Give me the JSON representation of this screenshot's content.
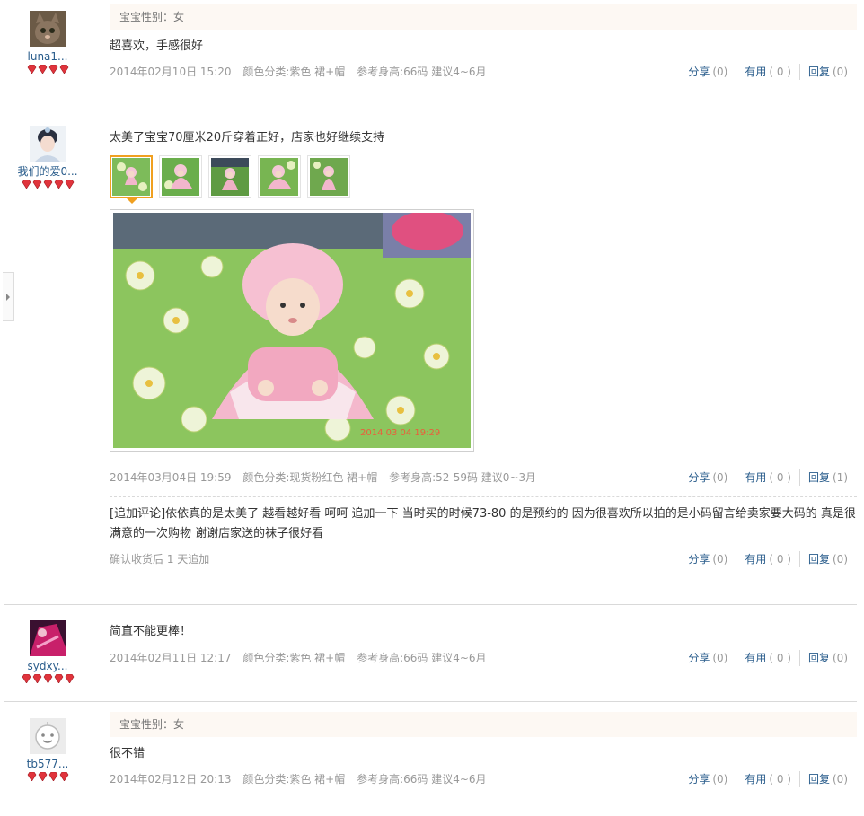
{
  "actions": {
    "share": "分享",
    "useful": "有用",
    "reply": "回复"
  },
  "reviews": [
    {
      "user": "luna1...",
      "gender": "宝宝性别：女",
      "text": "超喜欢，手感很好",
      "date": "2014年02月10日 15:20",
      "color": "颜色分类:紫色 裙+帽",
      "size": "参考身高:66码 建议4~6月",
      "share": "(0)",
      "useful": "( 0 )",
      "reply": "(0)"
    },
    {
      "user": "我们的爱0...",
      "text": "太美了宝宝70厘米20斤穿着正好，店家也好继续支持",
      "date": "2014年03月04日 19:59",
      "color": "颜色分类:现货粉红色 裙+帽",
      "size": "参考身高:52-59码 建议0~3月",
      "share": "(0)",
      "useful": "( 0 )",
      "reply": "(1)",
      "photo_stamp": "2014 03 04 19:29",
      "append_text": "[追加评论]依依真的是太美了 越看越好看 呵呵 追加一下 当时买的时候73-80 的是预约的 因为很喜欢所以拍的是小码留言给卖家要大码的 真是很满意的一次购物 谢谢店家送的袜子很好看",
      "append_meta": "确认收货后 1 天追加",
      "append_share": "(0)",
      "append_useful": "( 0 )",
      "append_reply": "(0)"
    },
    {
      "user": "sydxy...",
      "text": "简直不能更棒！",
      "date": "2014年02月11日 12:17",
      "color": "颜色分类:紫色 裙+帽",
      "size": "参考身高:66码 建议4~6月",
      "share": "(0)",
      "useful": "( 0 )",
      "reply": "(0)"
    },
    {
      "user": "tb577...",
      "gender": "宝宝性别：女",
      "text": "很不错",
      "date": "2014年02月12日 20:13",
      "color": "颜色分类:紫色 裙+帽",
      "size": "参考身高:66码 建议4~6月",
      "share": "(0)",
      "useful": "( 0 )",
      "reply": "(0)"
    }
  ],
  "colors": {
    "link": "#2a5d8c",
    "meta": "#999999",
    "gem": "#e0343c",
    "thumb_active": "#f0a020",
    "gender_bg": "#fdf8f3"
  },
  "icons": [
    "avatar-cat",
    "avatar-girl",
    "avatar-pink",
    "avatar-default",
    "rank-gem-icon",
    "side-collapse-arrow-icon"
  ]
}
